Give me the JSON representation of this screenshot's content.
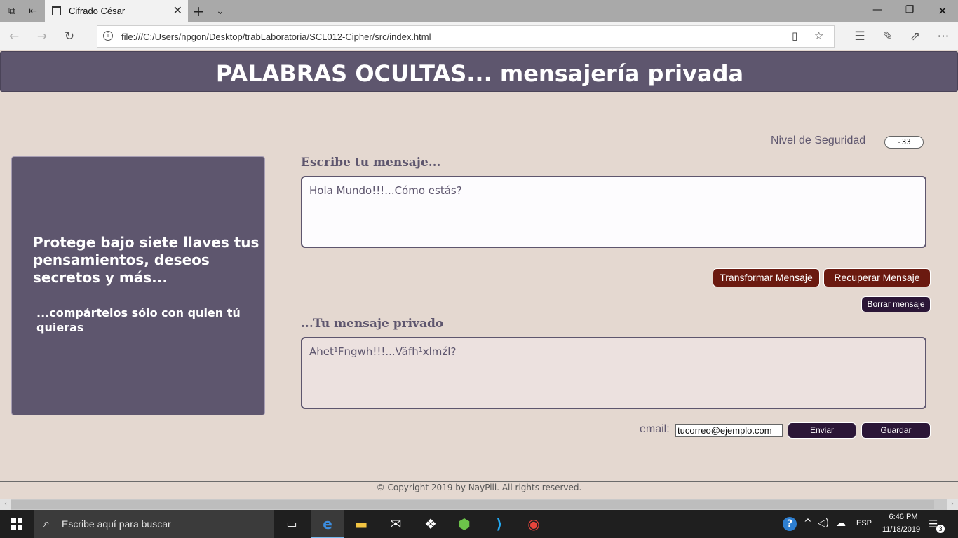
{
  "browser": {
    "tab_title": "Cifrado César",
    "url": "file:///C:/Users/npgon/Desktop/trabLaboratoria/SCL012-Cipher/src/index.html"
  },
  "page": {
    "title": "PALABRAS OCULTAS... mensajería privada",
    "left_heading": "Protege bajo siete llaves tus pensamientos, deseos secretos y más...",
    "left_sub": "...compártelos sólo con quien tú quieras",
    "security_label": "Nivel de Seguridad",
    "security_value": "-33",
    "input_label": "Escribe tu mensaje...",
    "input_value": "Hola Mundo!!!...Cómo estás?",
    "transform_label": "Transformar Mensaje",
    "recover_label": "Recuperar Mensaje",
    "clear_label": "Borrar mensaje",
    "output_label": "...Tu mensaje privado",
    "output_value": "Ahet¹Fngwh!!!...Vãfh¹xlmźl?",
    "email_label": "email:",
    "email_value": "tucorreo@ejemplo.com",
    "send_label": "Enviar",
    "save_label": "Guardar",
    "footer": "© Copyright 2019 by NayPili. All rights reserved."
  },
  "taskbar": {
    "search_placeholder": "Escribe aquí para buscar",
    "language": "ESP",
    "time": "6:46 PM",
    "date": "11/18/2019",
    "notification_count": "3"
  },
  "colors": {
    "page_bg": "#e4d8d0",
    "header_bg": "#5e566e",
    "button_red": "#6b1a10",
    "button_dark": "#2b1637"
  }
}
